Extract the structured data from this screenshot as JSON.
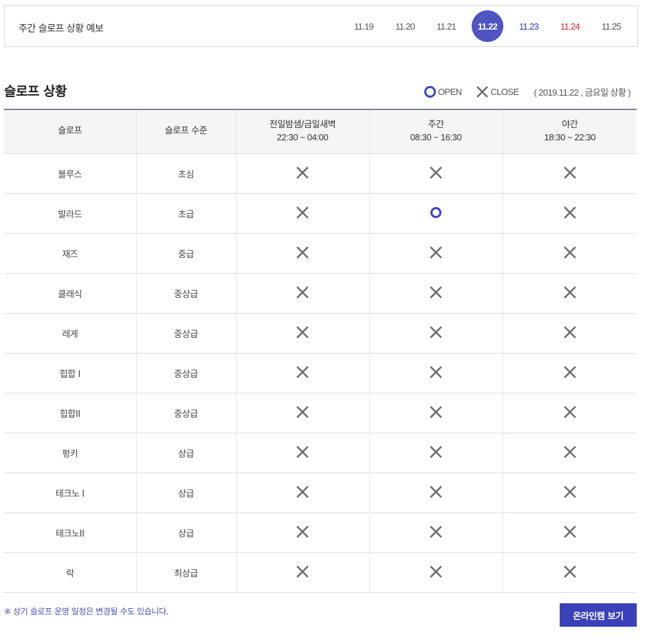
{
  "forecast": {
    "title": "주간 슬로프 상황 예보",
    "dates": [
      {
        "label": "11.19",
        "type": "weekday",
        "active": false
      },
      {
        "label": "11.20",
        "type": "weekday",
        "active": false
      },
      {
        "label": "11.21",
        "type": "weekday",
        "active": false
      },
      {
        "label": "11.22",
        "type": "weekday",
        "active": true
      },
      {
        "label": "11.23",
        "type": "sat",
        "active": false
      },
      {
        "label": "11.24",
        "type": "sun",
        "active": false
      },
      {
        "label": "11.25",
        "type": "weekday",
        "active": false
      }
    ]
  },
  "section": {
    "title": "슬로프 상황"
  },
  "legend": {
    "open_label": "OPEN",
    "close_label": "CLOSE",
    "status_date": "( 2019.11.22 , 금요일 상황 )"
  },
  "table": {
    "headers": {
      "slope": "슬로프",
      "level": "슬로프 수준",
      "night_name": "전일밤샘/금일새벽",
      "night_time": "22:30 ~ 04:00",
      "day_name": "주간",
      "day_time": "08:30 ~ 16:30",
      "evening_name": "야간",
      "evening_time": "18:30 ~ 22:30"
    },
    "rows": [
      {
        "name": "블루스",
        "level": "초심",
        "night": "close",
        "day": "close",
        "evening": "close"
      },
      {
        "name": "발라드",
        "level": "초급",
        "night": "close",
        "day": "open",
        "evening": "close"
      },
      {
        "name": "재즈",
        "level": "중급",
        "night": "close",
        "day": "close",
        "evening": "close"
      },
      {
        "name": "클래식",
        "level": "중상급",
        "night": "close",
        "day": "close",
        "evening": "close"
      },
      {
        "name": "레게",
        "level": "중상급",
        "night": "close",
        "day": "close",
        "evening": "close"
      },
      {
        "name": "힙합 I",
        "level": "중상급",
        "night": "close",
        "day": "close",
        "evening": "close"
      },
      {
        "name": "힙합II",
        "level": "중상급",
        "night": "close",
        "day": "close",
        "evening": "close"
      },
      {
        "name": "펑키",
        "level": "상급",
        "night": "close",
        "day": "close",
        "evening": "close"
      },
      {
        "name": "테크노 I",
        "level": "상급",
        "night": "close",
        "day": "close",
        "evening": "close"
      },
      {
        "name": "테크노II",
        "level": "상급",
        "night": "close",
        "day": "close",
        "evening": "close"
      },
      {
        "name": "락",
        "level": "최상급",
        "night": "close",
        "day": "close",
        "evening": "close"
      }
    ]
  },
  "footer": {
    "note": "※ 상기 슬로프 운영 일정은 변경될 수도 있습니다.",
    "cam_button": "온라인캠 보기"
  },
  "colors": {
    "accent": "#3a40b8",
    "open": "#3c45c4",
    "close": "#6e6e6e",
    "saturday": "#2a36d6",
    "sunday": "#e8242c"
  }
}
